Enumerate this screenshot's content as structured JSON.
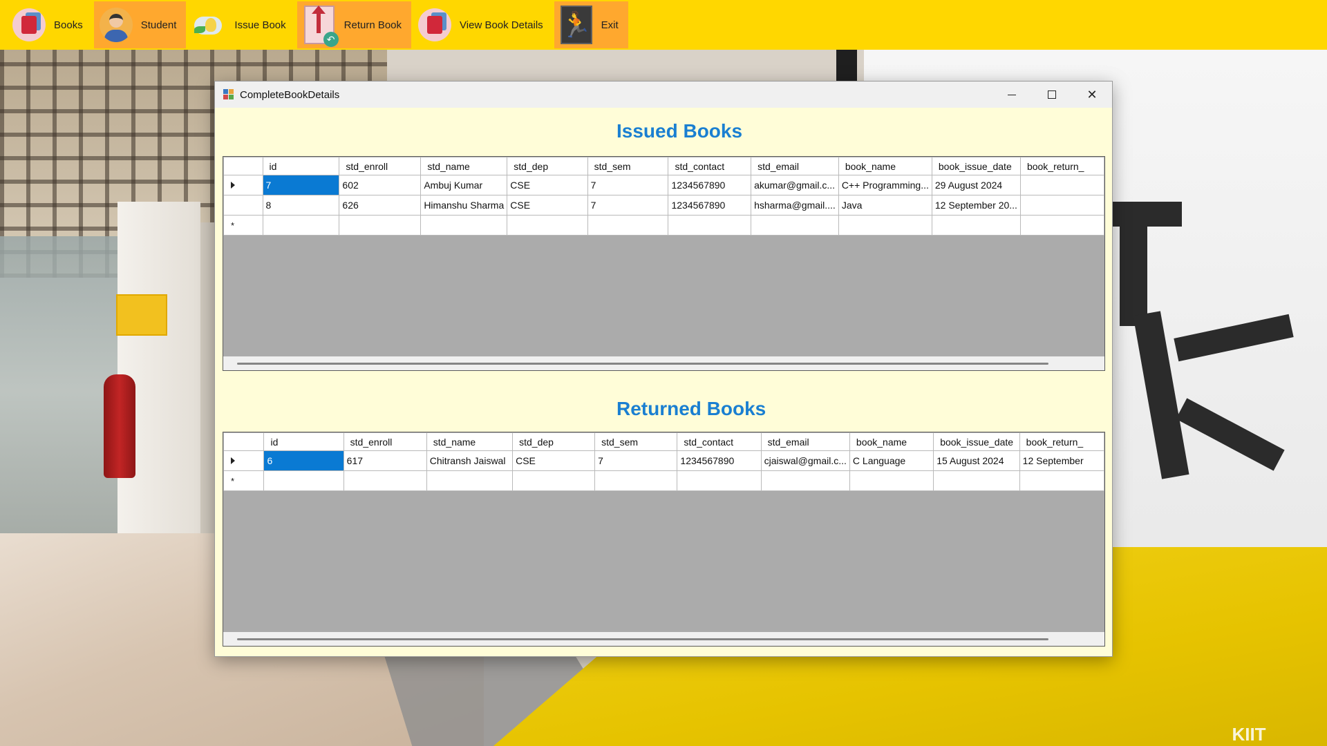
{
  "menu": [
    {
      "label": "Books",
      "icon": "books-icon"
    },
    {
      "label": "Student",
      "icon": "student-icon"
    },
    {
      "label": "Issue Book",
      "icon": "issue-book-icon"
    },
    {
      "label": "Return Book",
      "icon": "return-book-icon"
    },
    {
      "label": "View Book Details",
      "icon": "view-details-icon"
    },
    {
      "label": "Exit",
      "icon": "exit-icon"
    }
  ],
  "window": {
    "title": "CompleteBookDetails",
    "close_glyph": "✕"
  },
  "columns": [
    "id",
    "std_enroll",
    "std_name",
    "std_dep",
    "std_sem",
    "std_contact",
    "std_email",
    "book_name",
    "book_issue_date",
    "book_return_"
  ],
  "issued": {
    "heading": "Issued Books",
    "rows": [
      [
        "7",
        "602",
        "Ambuj Kumar",
        "CSE",
        "7",
        "1234567890",
        "akumar@gmail.c...",
        "C++ Programming...",
        "29 August 2024",
        ""
      ],
      [
        "8",
        "626",
        "Himanshu Sharma",
        "CSE",
        "7",
        "1234567890",
        "hsharma@gmail....",
        "Java",
        "12 September 20...",
        ""
      ]
    ]
  },
  "returned": {
    "heading": "Returned Books",
    "rows": [
      [
        "6",
        "617",
        "Chitransh Jaiswal",
        "CSE",
        "7",
        "1234567890",
        "cjaiswal@gmail.c...",
        "C Language",
        "15 August 2024",
        "12 September"
      ]
    ]
  },
  "colors": {
    "menubar": "#ffd700",
    "highlight": "#ffa82e",
    "heading": "#1a7fd1",
    "window_bg": "#fffdd8",
    "selection": "#0a7ad3"
  },
  "new_row_marker": "*",
  "watermark": "KIIT"
}
